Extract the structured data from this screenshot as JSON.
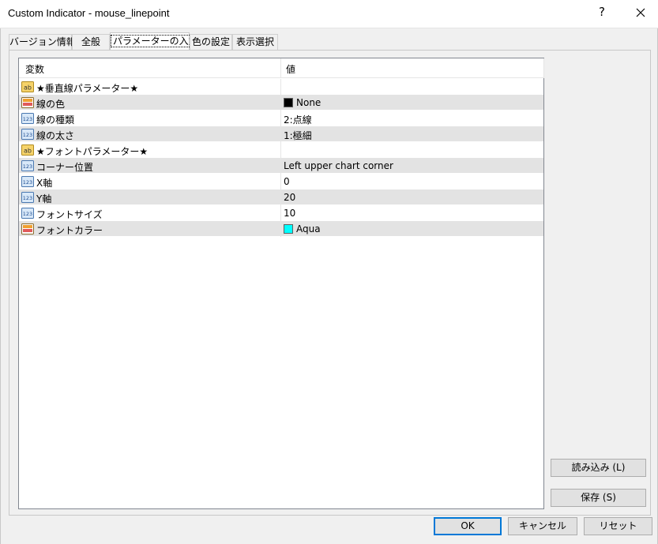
{
  "window": {
    "title": "Custom Indicator - mouse_linepoint",
    "help_label": "?"
  },
  "tabs": [
    {
      "label": "バージョン情報",
      "active": false
    },
    {
      "label": "全般",
      "active": false
    },
    {
      "label": "パラメーターの入力",
      "active": true
    },
    {
      "label": "色の設定",
      "active": false
    },
    {
      "label": "表示選択",
      "active": false
    }
  ],
  "grid": {
    "headers": {
      "name": "変数",
      "value": "値"
    },
    "rows": [
      {
        "icon": "string-param-icon",
        "name": "★垂直線パラメーター★",
        "value": ""
      },
      {
        "icon": "color-param-icon",
        "name": "線の色",
        "value": "None",
        "swatch": "#000000"
      },
      {
        "icon": "int-param-icon",
        "name": "線の種類",
        "value": "2:点線"
      },
      {
        "icon": "int-param-icon",
        "name": "線の太さ",
        "value": "1:極細"
      },
      {
        "icon": "string-param-icon",
        "name": "★フォントパラメーター★",
        "value": ""
      },
      {
        "icon": "int-param-icon",
        "name": "コーナー位置",
        "value": "Left upper chart corner"
      },
      {
        "icon": "int-param-icon",
        "name": "X軸",
        "value": "0"
      },
      {
        "icon": "int-param-icon",
        "name": "Y軸",
        "value": "20"
      },
      {
        "icon": "int-param-icon",
        "name": "フォントサイズ",
        "value": "10"
      },
      {
        "icon": "color-param-icon",
        "name": "フォントカラー",
        "value": "Aqua",
        "swatch": "#00ffff"
      }
    ]
  },
  "side_buttons": {
    "load_label": "読み込み (L)",
    "save_label": "保存 (S)"
  },
  "footer_buttons": {
    "ok_label": "OK",
    "cancel_label": "キャンセル",
    "reset_label": "リセット"
  },
  "colors": {
    "accent": "#0078d7",
    "alt_row": "#e3e3e3",
    "dialog_bg": "#f0f0f0"
  }
}
